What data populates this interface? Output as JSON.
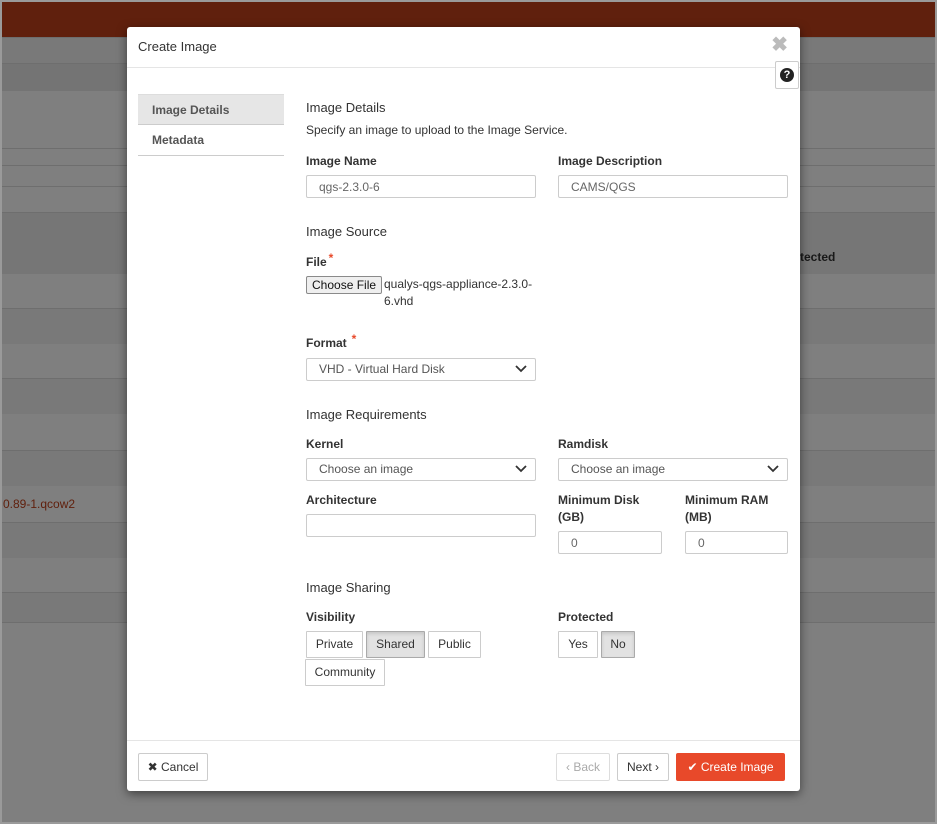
{
  "background": {
    "partial_text_protected": "tected",
    "partial_text_file": "0.89-1.qcow2"
  },
  "modal": {
    "title": "Create Image",
    "close_glyph": "✖",
    "help_glyph": "?"
  },
  "wizard_nav": {
    "items": [
      {
        "label": "Image Details",
        "active": true
      },
      {
        "label": "Metadata",
        "active": false
      }
    ]
  },
  "image_details": {
    "section_title": "Image Details",
    "help_text": "Specify an image to upload to the Image Service.",
    "image_name_label": "Image Name",
    "image_name_value": "qgs-2.3.0-6",
    "image_description_label": "Image Description",
    "image_description_value": "CAMS/QGS"
  },
  "image_source": {
    "section_title": "Image Source",
    "file_label": "File",
    "required_mark": "*",
    "choose_file_label": "Choose File",
    "file_name": "qualys-qgs-appliance-2.3.0-6.vhd",
    "format_label": "Format",
    "format_value": "VHD - Virtual Hard Disk"
  },
  "image_requirements": {
    "section_title": "Image Requirements",
    "kernel_label": "Kernel",
    "kernel_value": "Choose an image",
    "ramdisk_label": "Ramdisk",
    "ramdisk_value": "Choose an image",
    "architecture_label": "Architecture",
    "architecture_value": "",
    "min_disk_label": "Minimum Disk (GB)",
    "min_disk_value": "0",
    "min_ram_label": "Minimum RAM (MB)",
    "min_ram_value": "0"
  },
  "image_sharing": {
    "section_title": "Image Sharing",
    "visibility_label": "Visibility",
    "visibility_options": [
      "Private",
      "Shared",
      "Public",
      "Community"
    ],
    "visibility_selected": "Shared",
    "protected_label": "Protected",
    "protected_options": [
      "Yes",
      "No"
    ],
    "protected_selected": "No"
  },
  "footer": {
    "cancel_label": "Cancel",
    "back_label": "Back",
    "next_label": "Next",
    "create_label": "Create Image"
  },
  "colors": {
    "accent": "#e8492a",
    "topbar": "#c1411b"
  }
}
